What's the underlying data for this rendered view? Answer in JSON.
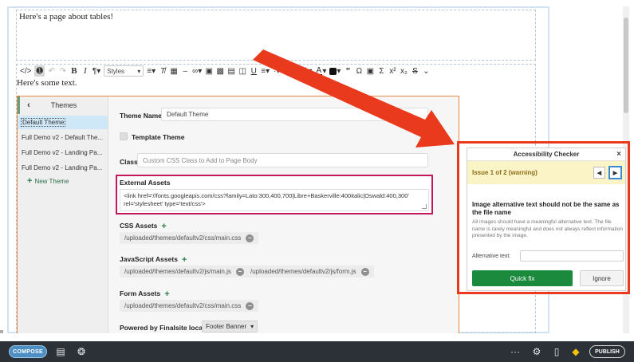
{
  "editor": {
    "page_text": "Here's a page about tables!",
    "body_text": "Here's some text.",
    "styles_label": "Styles"
  },
  "theme_sidebar": {
    "title": "Themes",
    "back_glyph": "‹",
    "items": [
      {
        "label": "Default Theme",
        "selected": true
      },
      {
        "label": "Full Demo v2 - Default The...",
        "selected": false
      },
      {
        "label": "Full Demo v2 - Landing Pa...",
        "selected": false
      },
      {
        "label": "Full Demo v2 - Landing Pa...",
        "selected": false
      }
    ],
    "new_theme_label": "New Theme"
  },
  "theme_form": {
    "theme_name_label": "Theme Name",
    "theme_name_value": "Default Theme",
    "template_theme_label": "Template Theme",
    "class_label": "Class",
    "class_placeholder": "Custom CSS Class to Add to Page Body",
    "external_assets_label": "External Assets",
    "external_assets_value": "<link href='//fonts.googleapis.com/css?family=Lato:300,400,700|Libre+Baskerville:400italic|Oswald:400,300' rel='stylesheet' type='text/css'>",
    "css_assets_label": "CSS Assets",
    "css_assets": [
      "/uploaded/themes/defaultv2/css/main.css"
    ],
    "js_assets_label": "JavaScript Assets",
    "js_assets": [
      "/uploaded/themes/defaultv2/js/main.js",
      "/uploaded/themes/defaultv2/js/form.js"
    ],
    "form_assets_label": "Form Assets",
    "form_assets": [
      "/uploaded/themes/defaultv2/css/main.css"
    ],
    "powered_by_label": "Powered by Finalsite location",
    "powered_by_value": "Footer Banner"
  },
  "accessibility_checker": {
    "title": "Accessibility Checker",
    "close_glyph": "×",
    "issue_label": "Issue 1 of 2 (warning)",
    "prev_glyph": "◀",
    "next_glyph": "▶",
    "issue_title": "Image alternative text should not be the same as the file name",
    "issue_description": "All images should have a meaningful alternative text. The file name is rarely meaningful and does not always reflect information presented by the image.",
    "alt_text_label": "Alternative text:",
    "alt_text_value": "",
    "quick_fix_label": "Quick fix",
    "ignore_label": "Ignore"
  },
  "bottom_bar": {
    "compose_label": "COMPOSE",
    "more_glyph": "···",
    "publish_label": "PUBLISH"
  },
  "colors": {
    "annotation_red": "#ea3a1e",
    "highlight_magenta": "#c4175e",
    "theme_panel_border": "#e58a3c",
    "quick_fix_green": "#1b8a3d",
    "bottom_bar_bg": "#2c3138"
  }
}
